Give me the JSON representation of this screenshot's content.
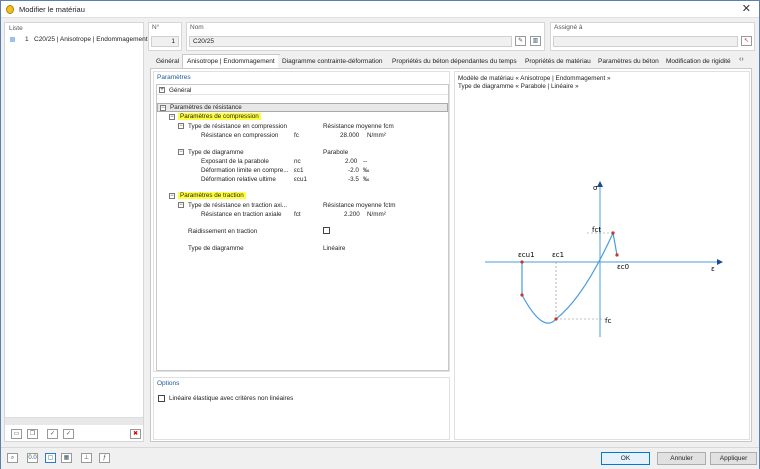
{
  "window": {
    "title": "Modifier le matériau"
  },
  "list": {
    "header": "Liste",
    "items": [
      {
        "num": "1",
        "label": "C20/25 | Anisotrope | Endommagement"
      }
    ]
  },
  "header_fields": {
    "no_label": "N°",
    "no_value": "1",
    "name_label": "Nom",
    "name_value": "C20/25",
    "assigned_label": "Assigné à",
    "assigned_value": ""
  },
  "tabs": [
    "Général",
    "Anisotrope | Endommagement",
    "Diagramme contrainte-déformation",
    "Propriétés du béton dépendantes du temps",
    "Propriétés de matériau",
    "Paramètres du béton",
    "Modification de rigidité"
  ],
  "params": {
    "title": "Paramètres",
    "general": "Général",
    "resistance": "Paramètres de résistance",
    "compression": "Paramètres de compression",
    "comp_type_label": "Type de résistance en compression",
    "comp_type_value": "Résistance moyenne fcm",
    "comp_res_label": "Résistance en compression",
    "comp_res_sym": "fc",
    "comp_res_value": "28.000",
    "comp_res_unit": "N/mm²",
    "diag_label": "Type de diagramme",
    "diag_value": "Parabole",
    "exp_label": "Exposant de la parabole",
    "exp_sym": "nc",
    "exp_value": "2.00",
    "exp_unit": "--",
    "def_lim_label": "Déformation limite en compre...",
    "def_lim_sym": "εc1",
    "def_lim_value": "-2.0",
    "def_lim_unit": "‰",
    "def_ult_label": "Déformation relative ultime",
    "def_ult_sym": "εcu1",
    "def_ult_value": "-3.5",
    "def_ult_unit": "‰",
    "traction": "Paramètres de traction",
    "trac_type_label": "Type de résistance en traction axi...",
    "trac_type_value": "Résistance moyenne fctm",
    "trac_res_label": "Résistance en traction axiale",
    "trac_res_sym": "fct",
    "trac_res_value": "2.200",
    "trac_res_unit": "N/mm²",
    "raid_label": "Raidissement en traction",
    "diag2_label": "Type de diagramme",
    "diag2_value": "Linéaire"
  },
  "options": {
    "title": "Options",
    "linear_label": "Linéaire élastique avec critères non linéaires"
  },
  "diagram": {
    "caption1": "Modèle de matériau « Anisotrope | Endommagement »",
    "caption2": "Type de diagramme « Parabole | Linéaire »",
    "sigma": "σ",
    "eps": "ε",
    "fct": "fct",
    "fc": "fc",
    "ecu1": "εcu1",
    "ec1": "εc1",
    "ec0": "εc0"
  },
  "buttons": {
    "ok": "OK",
    "cancel": "Annuler",
    "apply": "Appliquer"
  }
}
